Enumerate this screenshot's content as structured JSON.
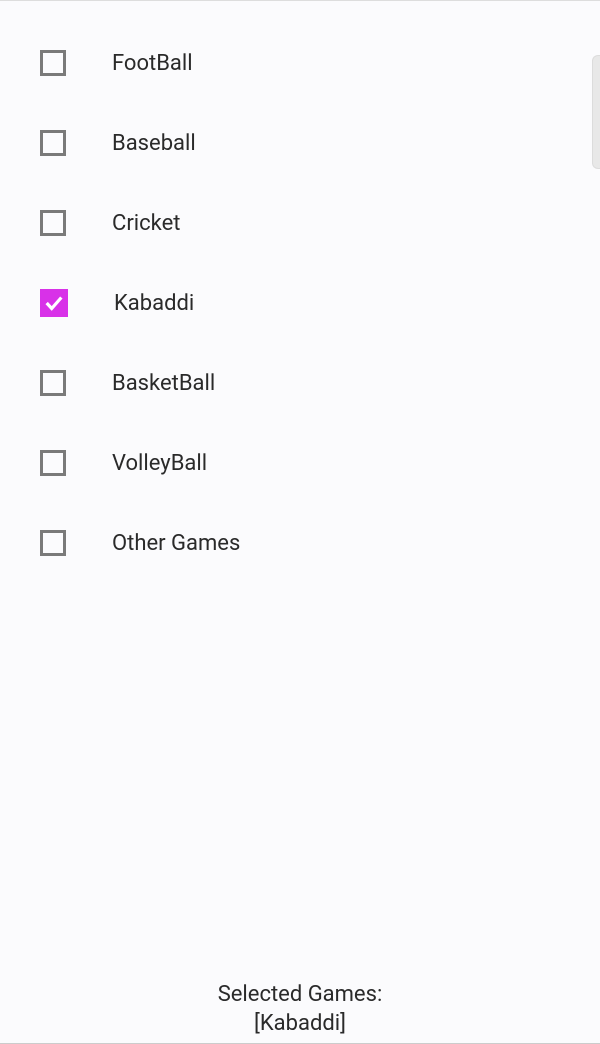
{
  "accent_color": "#d831e8",
  "games": [
    {
      "id": "football",
      "label": "FootBall",
      "checked": false
    },
    {
      "id": "baseball",
      "label": "Baseball",
      "checked": false
    },
    {
      "id": "cricket",
      "label": "Cricket",
      "checked": false
    },
    {
      "id": "kabaddi",
      "label": "Kabaddi",
      "checked": true
    },
    {
      "id": "basketball",
      "label": "BasketBall",
      "checked": false
    },
    {
      "id": "volleyball",
      "label": "VolleyBall",
      "checked": false
    },
    {
      "id": "other",
      "label": "Other Games",
      "checked": false
    }
  ],
  "footer": {
    "title": "Selected Games:",
    "value": "[Kabaddi]"
  }
}
